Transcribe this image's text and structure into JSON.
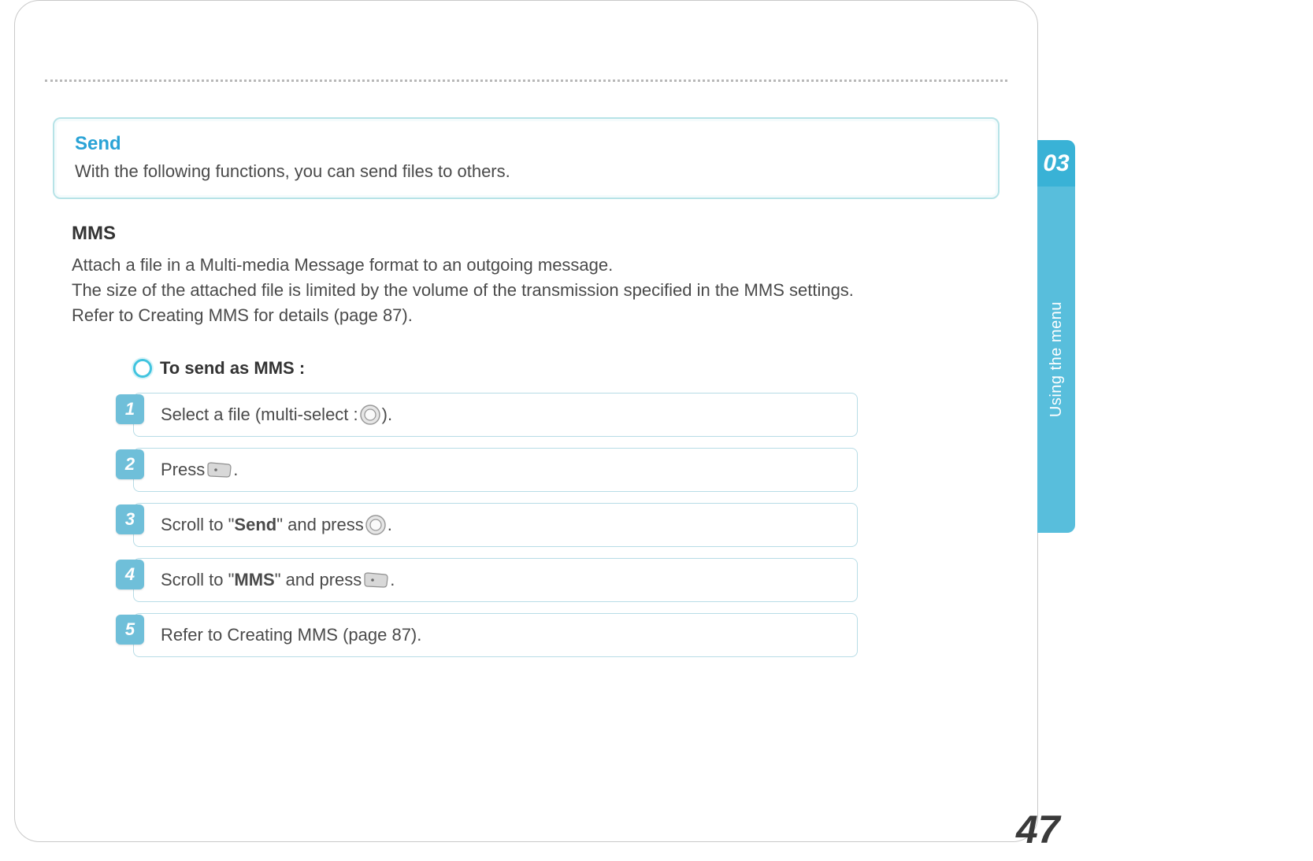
{
  "chapter_number": "03",
  "section_label": "Using the menu",
  "page_number": "47",
  "callout": {
    "title": "Send",
    "body": "With the following functions, you can send files to others."
  },
  "section": {
    "heading": "MMS",
    "body": "Attach a file in a Multi-media Message format to an outgoing message.\nThe size of the attached file is limited by the volume of the transmission specified in the MMS settings.\nRefer to Creating MMS for details (page 87)."
  },
  "steps": {
    "title": "To send as MMS :",
    "items": [
      {
        "n": "1",
        "pre": "Select a file (multi-select : ",
        "icon": "circle",
        "post": ")."
      },
      {
        "n": "2",
        "pre": "Press ",
        "icon": "soft",
        "post": "."
      },
      {
        "n": "3",
        "pre": "Scroll to \"",
        "bold": "Send",
        "mid": "\" and press ",
        "icon": "circle",
        "post": "."
      },
      {
        "n": "4",
        "pre": "Scroll to \"",
        "bold": "MMS",
        "mid": "\" and press ",
        "icon": "soft",
        "post": "."
      },
      {
        "n": "5",
        "pre": "Refer to Creating MMS (page 87).",
        "icon": "",
        "post": ""
      }
    ]
  }
}
